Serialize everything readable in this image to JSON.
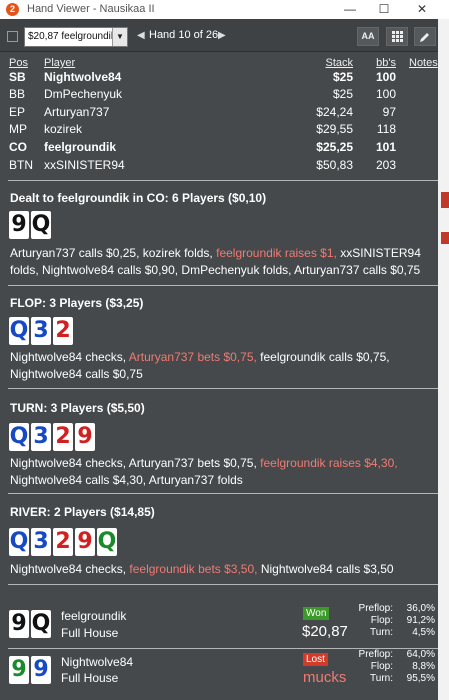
{
  "window": {
    "app_icon": "2",
    "title": "Hand Viewer - Nausikaa II",
    "minimize": "—",
    "maximize": "☐",
    "close": "✕"
  },
  "toolbar": {
    "player_select": "$20,87 feelgroundil",
    "hand_label": "Hand 10 of 26",
    "font_button": "AA"
  },
  "table": {
    "headers": {
      "pos": "Pos",
      "player": "Player",
      "stack": "Stack",
      "bbs": "bb's",
      "notes": "Notes"
    },
    "rows": [
      {
        "pos": "SB",
        "player": "Nightwolve84",
        "stack": "$25",
        "bbs": "100",
        "bold": true
      },
      {
        "pos": "BB",
        "player": "DmPechenyuk",
        "stack": "$25",
        "bbs": "100",
        "bold": false
      },
      {
        "pos": "EP",
        "player": "Arturyan737",
        "stack": "$24,24",
        "bbs": "97",
        "bold": false
      },
      {
        "pos": "MP",
        "player": "kozirek",
        "stack": "$29,55",
        "bbs": "118",
        "bold": false
      },
      {
        "pos": "CO",
        "player": "feelgroundik",
        "stack": "$25,25",
        "bbs": "101",
        "bold": true
      },
      {
        "pos": "BTN",
        "player": "xxSINISTER94",
        "stack": "$50,83",
        "bbs": "203",
        "bold": false
      }
    ]
  },
  "preflop": {
    "title": "Dealt to feelgroundik in CO: 6 Players ($0,10)",
    "cards": [
      {
        "rank": "9",
        "suit": "s"
      },
      {
        "rank": "Q",
        "suit": "s"
      }
    ],
    "action": {
      "a": "Arturyan737 calls $0,25, kozirek folds, ",
      "b": "feelgroundik raises $1,",
      "c": " xxSINISTER94 folds, Nightwolve84 calls $0,90, DmPechenyuk folds, Arturyan737 calls $0,75"
    }
  },
  "flop": {
    "title": "FLOP: 3 Players ($3,25)",
    "cards": [
      {
        "rank": "Q",
        "suit": "d"
      },
      {
        "rank": "3",
        "suit": "d"
      },
      {
        "rank": "2",
        "suit": "h"
      }
    ],
    "action": {
      "a": "Nightwolve84 checks, ",
      "b": "Arturyan737 bets $0,75,",
      "c": " feelgroundik calls $0,75, Nightwolve84 calls $0,75"
    }
  },
  "turn": {
    "title": "TURN: 3 Players ($5,50)",
    "cards": [
      {
        "rank": "Q",
        "suit": "d"
      },
      {
        "rank": "3",
        "suit": "d"
      },
      {
        "rank": "2",
        "suit": "h"
      },
      {
        "rank": "9",
        "suit": "h"
      }
    ],
    "action": {
      "a": "Nightwolve84 checks, Arturyan737 bets $0,75, ",
      "b": "feelgroundik raises $4,30,",
      "c": " Nightwolve84 calls $4,30, Arturyan737 folds"
    }
  },
  "river": {
    "title": "RIVER: 2 Players ($14,85)",
    "cards": [
      {
        "rank": "Q",
        "suit": "d"
      },
      {
        "rank": "3",
        "suit": "d"
      },
      {
        "rank": "2",
        "suit": "h"
      },
      {
        "rank": "9",
        "suit": "h"
      },
      {
        "rank": "Q",
        "suit": "c"
      }
    ],
    "action": {
      "a": "Nightwolve84 checks, ",
      "b": "feelgroundik bets $3,50,",
      "c": " Nightwolve84 calls $3,50"
    }
  },
  "results": [
    {
      "player": "feelgroundik",
      "hand": "Full House",
      "cards": [
        {
          "rank": "9",
          "suit": "s"
        },
        {
          "rank": "Q",
          "suit": "s"
        }
      ],
      "badge": "Won",
      "outcome": "$20,87",
      "equity": {
        "preflop_label": "Preflop:",
        "preflop": "36,0%",
        "flop_label": "Flop:",
        "flop": "91,2%",
        "turn_label": "Turn:",
        "turn": "4,5%"
      }
    },
    {
      "player": "Nightwolve84",
      "hand": "Full House",
      "cards": [
        {
          "rank": "9",
          "suit": "c"
        },
        {
          "rank": "9",
          "suit": "d"
        }
      ],
      "badge": "Lost",
      "outcome": "mucks",
      "equity": {
        "preflop_label": "Preflop:",
        "preflop": "64,0%",
        "flop_label": "Flop:",
        "flop": "8,8%",
        "turn_label": "Turn:",
        "turn": "95,5%"
      }
    }
  ],
  "colors": {
    "panel": "#45494c",
    "highlight": "#f07b72",
    "won": "#3b9a2a",
    "lost": "#d23a2a"
  }
}
